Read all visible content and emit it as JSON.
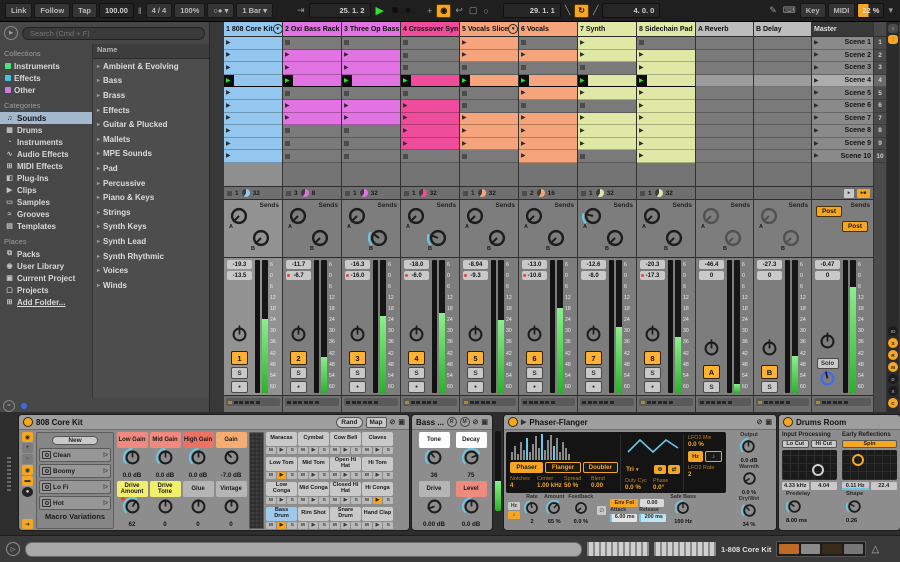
{
  "icons": {
    "bars": "‖",
    "metronome": "○●",
    "dropdown": "▾",
    "follow_arrow": "⇥",
    "play": "▶",
    "stop": "■",
    "record": "●",
    "plus": "+",
    "overdub": "◉",
    "back": "↩",
    "select_box": "▢",
    "ring": "○",
    "punch_in": "╲",
    "loop": "↻",
    "punch_out": "╱",
    "draw": "✎",
    "keyboard": "⌨",
    "preview": "▷",
    "hotswap": "⊘",
    "save": "▣",
    "phase": "Φ",
    "swap": "⇄",
    "empty_set": "∅",
    "bell": "△",
    "approx": "≈",
    "chev": "▸",
    "expand": "▶"
  },
  "transport": {
    "link": "Link",
    "follow": "Follow",
    "tap": "Tap",
    "tempo": "100.00",
    "sig": "4 / 4",
    "groove": "100%",
    "quantize": "1 Bar",
    "position": "25. 1. 2",
    "loop_start": "29. 1. 1",
    "loop_length": "4. 0. 0",
    "key": "Key",
    "midi": "MIDI",
    "cpu": "22 %"
  },
  "browser": {
    "search_placeholder": "Search (Cmd + F)",
    "collections": {
      "label": "Collections",
      "items": [
        {
          "label": "Instruments",
          "color": "#4be37a"
        },
        {
          "label": "Effects",
          "color": "#3fc4e8"
        },
        {
          "label": "Other",
          "color": "#c77ee0"
        }
      ]
    },
    "categories": {
      "label": "Categories",
      "items": [
        {
          "label": "Sounds",
          "icon": "note-icon",
          "selected": true
        },
        {
          "label": "Drums",
          "icon": "drum-pads-icon"
        },
        {
          "label": "Instruments",
          "icon": "instrument-icon"
        },
        {
          "label": "Audio Effects",
          "icon": "audio-fx-icon"
        },
        {
          "label": "MIDI Effects",
          "icon": "midi-fx-icon"
        },
        {
          "label": "Plug-Ins",
          "icon": "plug-icon"
        },
        {
          "label": "Clips",
          "icon": "clip-icon"
        },
        {
          "label": "Samples",
          "icon": "sample-icon"
        },
        {
          "label": "Grooves",
          "icon": "groove-icon"
        },
        {
          "label": "Templates",
          "icon": "template-icon"
        }
      ]
    },
    "places": {
      "label": "Places",
      "items": [
        {
          "label": "Packs",
          "icon": "packs-icon"
        },
        {
          "label": "User Library",
          "icon": "user-icon"
        },
        {
          "label": "Current Project",
          "icon": "current-project-icon"
        },
        {
          "label": "Projects",
          "icon": "folder-icon"
        },
        {
          "label": "Add Folder...",
          "icon": "add-folder-icon",
          "underline": true
        }
      ]
    },
    "list_header": "Name",
    "folders": [
      "Ambient & Evolving",
      "Bass",
      "Brass",
      "Effects",
      "Guitar & Plucked",
      "Mallets",
      "MPE Sounds",
      "Pad",
      "Percussive",
      "Piano & Keys",
      "Strings",
      "Synth Keys",
      "Synth Lead",
      "Synth Rhythmic",
      "Voices",
      "Winds"
    ]
  },
  "session": {
    "sends_label": "Sends",
    "solo_btn": "S",
    "db_scale": [
      "6",
      "0",
      "6",
      "12",
      "18",
      "24",
      "30",
      "36",
      "42",
      "48",
      "54",
      "60"
    ],
    "tracks": [
      {
        "name": "1 808 Core Kit",
        "color": "#93c7ef",
        "selected": true,
        "menu": true,
        "slots": [
          "clip",
          "clip",
          "clip",
          "play",
          "clip",
          "clip",
          "clip",
          "clip",
          "clip",
          "clip"
        ],
        "quant": "1",
        "len": "32",
        "peak": "-19.3",
        "vol": "-13.5",
        "vol_dot": false,
        "num": "1",
        "level": 0.56,
        "send_a": 0,
        "send_b": 0,
        "mini_on": true
      },
      {
        "name": "2 Oxi Bass Rack",
        "color": "#e273e2",
        "slots": [
          "stop",
          "clip",
          "clip",
          "play",
          "stop",
          "clip",
          "clip",
          "stop",
          "stop",
          "stop"
        ],
        "quant": "3",
        "len": "8",
        "peak": "-11.7",
        "vol": "-6.7",
        "vol_dot": true,
        "num": "2",
        "level": 0.27,
        "send_a": 0,
        "send_b": 0,
        "mini_on": false
      },
      {
        "name": "3 Three Op Bass",
        "color": "#e273e2",
        "slots": [
          "stop",
          "clip",
          "clip",
          "play",
          "stop",
          "clip",
          "clip",
          "stop",
          "stop",
          "stop"
        ],
        "quant": "1",
        "len": "32",
        "peak": "-16.3",
        "vol": "-16.0",
        "vol_dot": true,
        "num": "3",
        "level": 0.58,
        "send_a": 0,
        "send_b": 0.3,
        "mini_on": false
      },
      {
        "name": "4 Crossover Syn",
        "color": "#ef4d9b",
        "slots": [
          "stop",
          "stop",
          "stop",
          "play",
          "stop",
          "clip",
          "clip",
          "clip",
          "clip",
          "stop"
        ],
        "quant": "1",
        "len": "32",
        "peak": "-18.0",
        "vol": "-6.0",
        "vol_dot": true,
        "num": "4",
        "level": 0.6,
        "send_a": 0,
        "send_b": 0.25,
        "mini_on": true
      },
      {
        "name": "5 Vocals Slice",
        "color": "#f5a47b",
        "menu": true,
        "slots": [
          "clip",
          "clip",
          "stop",
          "play",
          "stop",
          "stop",
          "clip",
          "clip",
          "clip",
          "stop"
        ],
        "quant": "1",
        "len": "32",
        "peak": "-8.94",
        "vol": "-9.3",
        "vol_dot": true,
        "num": "5",
        "level": 0.55,
        "send_a": 0,
        "send_b": 0,
        "mini_on": true
      },
      {
        "name": "6 Vocals",
        "color": "#f5a47b",
        "slots": [
          "stop",
          "clip",
          "stop",
          "play",
          "clip",
          "stop",
          "clip",
          "clip",
          "clip",
          "clip"
        ],
        "quant": "2",
        "len": "16",
        "peak": "-13.0",
        "vol": "-10.6",
        "vol_dot": true,
        "num": "6",
        "level": 0.64,
        "send_a": 0,
        "send_b": 0,
        "mini_on": false
      },
      {
        "name": "7 Synth",
        "color": "#dfe8a5",
        "slots": [
          "clip",
          "clip",
          "stop",
          "play",
          "clip",
          "stop",
          "clip",
          "clip",
          "clip",
          "stop"
        ],
        "quant": "1",
        "len": "32",
        "peak": "-12.6",
        "vol": "-8.0",
        "vol_dot": false,
        "num": "7",
        "level": 0.5,
        "send_a": 0.22,
        "send_b": 0,
        "mini_on": false
      },
      {
        "name": "8 Sidechain Pad",
        "color": "#dfe8a5",
        "slots": [
          "stop",
          "clip",
          "clip",
          "play",
          "clip",
          "clip",
          "clip",
          "clip",
          "clip",
          "clip"
        ],
        "quant": "1",
        "len": "32",
        "peak": "-20.3",
        "vol": "-17.3",
        "vol_dot": true,
        "num": "8",
        "level": 0.42,
        "send_a": 0,
        "send_b": 0,
        "mini_on": true
      }
    ],
    "returns": [
      {
        "name": "A Reverb",
        "peak": "-46.4",
        "vol": "0",
        "num": "A",
        "level": 0.07,
        "mini_on": false
      },
      {
        "name": "B Delay",
        "peak": "-27.3",
        "vol": "0",
        "num": "B",
        "level": 0.28,
        "mini_on": true
      }
    ],
    "master": {
      "name": "Master",
      "peak": "-0.47",
      "vol": "0",
      "post_a": "Post",
      "post_b": "Post",
      "solo_label": "Solo",
      "level": 0.8,
      "mini_on": true
    },
    "scenes": [
      {
        "name": "Scene 1",
        "num": "1"
      },
      {
        "name": "Scene 2",
        "num": "2"
      },
      {
        "name": "Scene 3",
        "num": "3"
      },
      {
        "name": "Scene 4",
        "num": "4"
      },
      {
        "name": "Scene 5",
        "num": "5"
      },
      {
        "name": "Scene 6",
        "num": "6"
      },
      {
        "name": "Scene 7",
        "num": "7"
      },
      {
        "name": "Scene 8",
        "num": "8"
      },
      {
        "name": "Scene 9",
        "num": "9"
      },
      {
        "name": "Scene 10",
        "num": "10"
      }
    ],
    "selected_scene_index": 3
  },
  "right_toggles": [
    {
      "label": "IO",
      "on": false
    },
    {
      "label": "S",
      "on": true
    },
    {
      "label": "R",
      "on": true
    },
    {
      "label": "M",
      "on": true
    },
    {
      "label": "D",
      "on": false
    },
    {
      "label": "X",
      "on": false
    },
    {
      "label": "C",
      "on": true
    }
  ],
  "devices": {
    "rack": {
      "title": "808 Core Kit",
      "rand": "Rand",
      "map": "Map",
      "new_btn": "New",
      "variations": [
        "Clean",
        "Boomy",
        "Lo Fi",
        "Hot"
      ],
      "variations_label": "Macro Variations",
      "macros": [
        {
          "label": "Low Gain",
          "value": "0.0 dB",
          "color": "#ee8a7e",
          "frac": 0.5,
          "arc": true
        },
        {
          "label": "Mid Gain",
          "value": "0.0 dB",
          "color": "#ee8a7e",
          "frac": 0.5,
          "arc": true
        },
        {
          "label": "High Gain",
          "value": "0.0 dB",
          "color": "#ec7265",
          "frac": 0.5,
          "arc": true
        },
        {
          "label": "Gain",
          "value": "-7.0 dB",
          "color": "#f6ad74",
          "frac": 0.34,
          "arc": false
        },
        {
          "label": "Drive Amount",
          "value": "62",
          "color": "#f2ef6d",
          "frac": 0.62,
          "arc": true,
          "dot": true
        },
        {
          "label": "Drive Tone",
          "value": "0",
          "color": "#f2ef6d",
          "frac": 0.5,
          "arc": false
        },
        {
          "label": "Glue",
          "value": "0",
          "color": "",
          "frac": 0.5,
          "arc": false
        },
        {
          "label": "Vintage",
          "value": "0",
          "color": "",
          "frac": 0.5,
          "arc": false
        }
      ],
      "pads": [
        {
          "name": "Maracas"
        },
        {
          "name": "Cymbal"
        },
        {
          "name": "Cow Bell"
        },
        {
          "name": "Claves"
        },
        {
          "name": "Low Tom",
          "playing": true
        },
        {
          "name": "Mid Tom"
        },
        {
          "name": "Open Hi Hat"
        },
        {
          "name": "Hi Tom"
        },
        {
          "name": "Low Conga"
        },
        {
          "name": "Mid Conga"
        },
        {
          "name": "Closed Hi Hat"
        },
        {
          "name": "Hi Conga",
          "playing": true
        },
        {
          "name": "Bass Drum",
          "selected": true,
          "playing": true
        },
        {
          "name": "Rim Shot"
        },
        {
          "name": "Snare Drum"
        },
        {
          "name": "Hand Clap"
        }
      ],
      "pad_mute": "M",
      "pad_solo": "S"
    },
    "bass": {
      "title": "Bass ...",
      "macros": [
        {
          "label": "Tone",
          "value": "36",
          "color": "#ffffff",
          "frac": 0.36,
          "arc": true
        },
        {
          "label": "Decay",
          "value": "75",
          "color": "#ffffff",
          "frac": 0.75,
          "arc": true
        },
        {
          "label": "Drive",
          "value": "0.00 dB",
          "color": "",
          "frac": 0.1,
          "arc": false
        },
        {
          "label": "Level",
          "value": "0.0 dB",
          "color": "#ee8a7e",
          "frac": 0.5,
          "arc": true
        }
      ]
    },
    "phaser": {
      "title": "Phaser-Flanger",
      "tabs": [
        "Phaser",
        "Flanger",
        "Doubler"
      ],
      "active_tab": 0,
      "params": [
        {
          "label": "Notches",
          "value": "4"
        },
        {
          "label": "Center",
          "value": "1.00 kHz"
        },
        {
          "label": "Spread",
          "value": "50 %"
        },
        {
          "label": "Blend",
          "value": "0.00"
        }
      ],
      "wave": "Tri",
      "duty_label": "Duty Cyc",
      "duty": "0.0 %",
      "phase_label": "Phase",
      "phase": "0.0°",
      "lfo2_mix_label": "LFO2 Mix",
      "lfo2_mix": "0.0 %",
      "hz": "Hz",
      "note": "♪",
      "lfo2_rate_label": "LFO2 Rate",
      "lfo2_rate": "2",
      "controls": [
        {
          "label": "Rate",
          "value": "2",
          "frac": 0.45
        },
        {
          "label": "Amount",
          "value": "65 %",
          "frac": 0.65
        },
        {
          "label": "Feedback",
          "value": "0.0 %",
          "frac": 0.02
        }
      ],
      "env_fol": "Env Fol",
      "env_amount": "0.00",
      "attack_label": "Attack",
      "attack": "6.00 ms",
      "release_label": "Release",
      "release": "200 ms",
      "safe_bass_label": "Safe Bass",
      "safe_bass": "100 Hz",
      "safe_bass_frac": 0.5,
      "output_label": "Output",
      "output": "0.0 dB",
      "warmth_label": "Warmth",
      "warmth": "0.0 %",
      "drywet_label": "Dry/Wet",
      "drywet": "34 %",
      "drywet_frac": 0.34
    },
    "reverb": {
      "title": "Drums Room",
      "input_label": "Input Processing",
      "lo_cut": "Lo Cut",
      "hi_cut": "Hi Cut",
      "freq": "4.33 kHz",
      "q": "4.04",
      "early_label": "Early Reflections",
      "spin": "Spin",
      "spin_rate": "0.11 Hz",
      "spin_amount": "22.4",
      "predelay_label": "Predelay",
      "predelay": "8.00 ms",
      "predelay_frac": 0.3,
      "shape_label": "Shape",
      "shape": "0.26",
      "shape_frac": 0.28
    }
  },
  "statusbar": {
    "selection": "1-808 Core Kit"
  }
}
